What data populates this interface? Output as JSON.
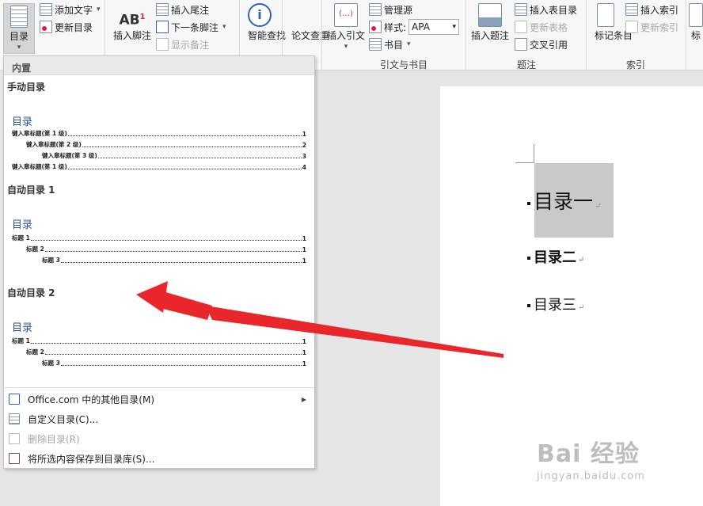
{
  "ribbon": {
    "toc_button": "目录",
    "add_text": "添加文字",
    "update_toc": "更新目录",
    "insert_footnote": "插入脚注",
    "insert_endnote": "插入尾注",
    "next_footnote": "下一条脚注",
    "show_notes": "显示备注",
    "smart_lookup": "智能查找",
    "paper_check": "论文查重",
    "insert_citation": "插入引文",
    "manage_sources": "管理源",
    "style_label": "样式:",
    "style_value": "APA",
    "bibliography": "书目",
    "insert_caption": "插入题注",
    "insert_table_of_figures": "插入表目录",
    "update_table": "更新表格",
    "cross_reference": "交叉引用",
    "mark_entry": "标记条目",
    "insert_index": "插入索引",
    "update_index": "更新索引",
    "mark_citation_partial": "标",
    "group_citations": "引文与书目",
    "group_captions": "题注",
    "group_index": "索引",
    "ab_label": "AB",
    "ab_sup": "1"
  },
  "toc_menu": {
    "builtin": "内置",
    "manual_title": "手动目录",
    "auto1_title": "自动目录 1",
    "auto2_title": "自动目录 2",
    "preview_heading": "目录",
    "manual_lines": [
      {
        "text": "键入章标题(第 1 级)",
        "page": "1"
      },
      {
        "text": "键入章标题(第 2 级)",
        "page": "2"
      },
      {
        "text": "键入章标题(第 3 级)",
        "page": "3"
      },
      {
        "text": "键入章标题(第 1 级)",
        "page": "4"
      }
    ],
    "auto_lines": [
      {
        "text": "标题 1",
        "page": "1"
      },
      {
        "text": "标题 2",
        "page": "1"
      },
      {
        "text": "标题 3",
        "page": "1"
      }
    ],
    "more_toc": "Office.com 中的其他目录(M)",
    "custom_toc": "自定义目录(C)...",
    "remove_toc": "删除目录(R)",
    "save_selection": "将所选内容保存到目录库(S)..."
  },
  "document": {
    "heading1": "目录一",
    "heading2": "目录二",
    "heading3": "目录三"
  },
  "watermark": {
    "main": "Bai 经验",
    "sub": "jingyan.baidu.com"
  },
  "colors": {
    "accent_blue": "#2e5395",
    "arrow_red": "#e8262b"
  }
}
